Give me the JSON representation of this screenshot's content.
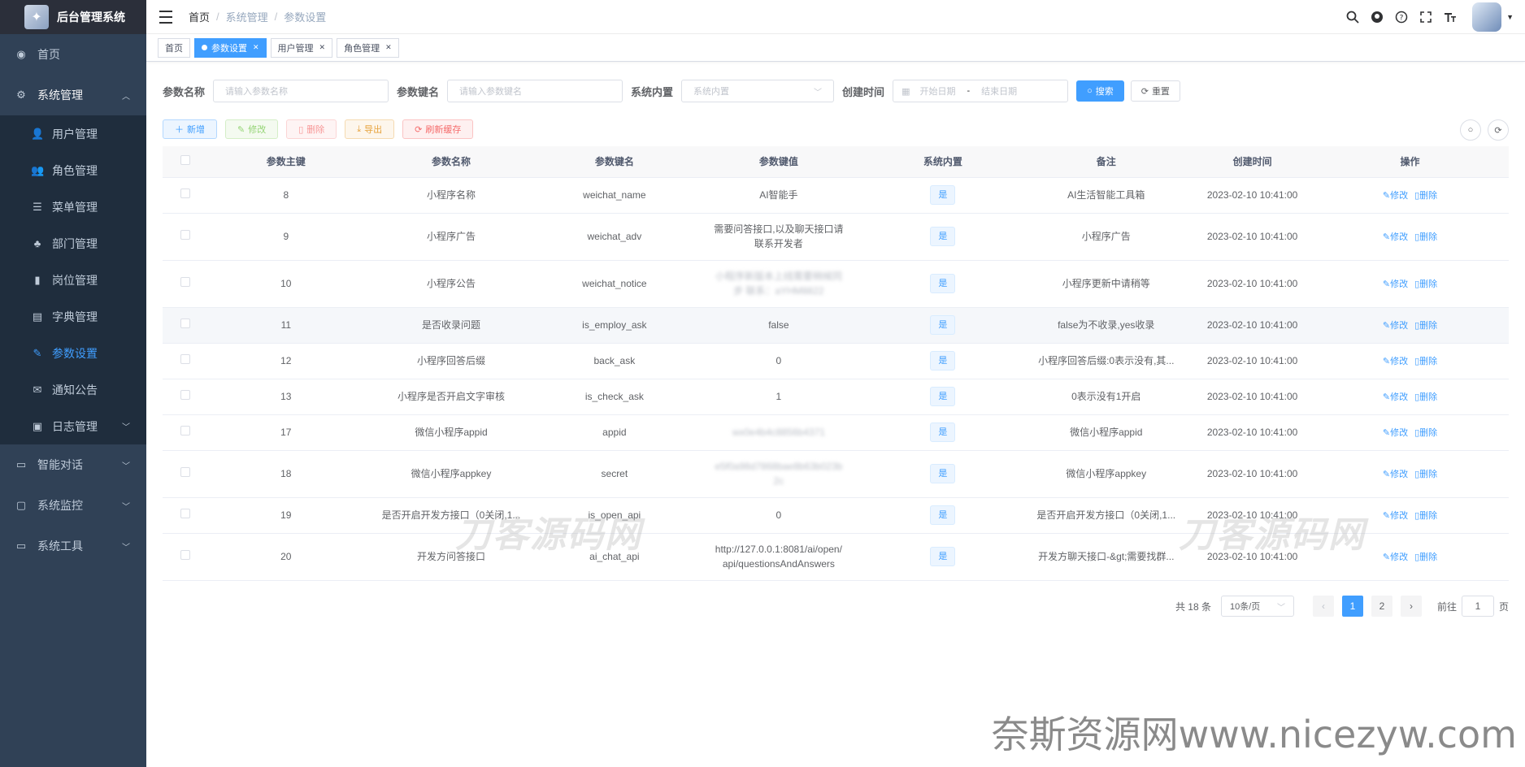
{
  "app": {
    "title": "后台管理系统"
  },
  "sidebar": {
    "items": [
      {
        "label": "首页",
        "icon": "dashboard-icon"
      },
      {
        "label": "系统管理",
        "icon": "gear-icon",
        "expanded": true,
        "children": [
          {
            "label": "用户管理",
            "icon": "user-icon"
          },
          {
            "label": "角色管理",
            "icon": "peoples-icon"
          },
          {
            "label": "菜单管理",
            "icon": "tree-table-icon"
          },
          {
            "label": "部门管理",
            "icon": "tree-icon"
          },
          {
            "label": "岗位管理",
            "icon": "post-icon"
          },
          {
            "label": "字典管理",
            "icon": "dict-icon"
          },
          {
            "label": "参数设置",
            "icon": "edit-icon",
            "active": true
          },
          {
            "label": "通知公告",
            "icon": "message-icon"
          },
          {
            "label": "日志管理",
            "icon": "log-icon"
          }
        ]
      },
      {
        "label": "智能对话",
        "icon": "chat-icon"
      },
      {
        "label": "系统监控",
        "icon": "monitor-icon"
      },
      {
        "label": "系统工具",
        "icon": "tool-icon"
      }
    ]
  },
  "navbar": {
    "breadcrumb": [
      "首页",
      "系统管理",
      "参数设置"
    ],
    "icons": [
      "search-icon",
      "github-icon",
      "question-icon",
      "fullscreen-icon",
      "font-size-icon"
    ]
  },
  "tags": [
    {
      "label": "首页",
      "closable": false,
      "active": false
    },
    {
      "label": "参数设置",
      "closable": true,
      "active": true
    },
    {
      "label": "用户管理",
      "closable": true,
      "active": false
    },
    {
      "label": "角色管理",
      "closable": true,
      "active": false
    }
  ],
  "search": {
    "param_name_label": "参数名称",
    "param_name_placeholder": "请输入参数名称",
    "param_key_label": "参数键名",
    "param_key_placeholder": "请输入参数键名",
    "builtin_label": "系统内置",
    "builtin_placeholder": "系统内置",
    "created_label": "创建时间",
    "start_placeholder": "开始日期",
    "end_placeholder": "结束日期",
    "range_separator": "-",
    "search_btn": "搜索",
    "reset_btn": "重置"
  },
  "toolbar": {
    "add": "新增",
    "edit": "修改",
    "delete": "删除",
    "export": "导出",
    "refresh_cache": "刷新缓存"
  },
  "table": {
    "columns": [
      "参数主键",
      "参数名称",
      "参数键名",
      "参数键值",
      "系统内置",
      "备注",
      "创建时间",
      "操作"
    ],
    "rows": [
      {
        "id": "8",
        "name": "小程序名称",
        "key": "weichat_name",
        "value": "AI智能手",
        "builtin": "是",
        "remark": "AI生活智能工具箱",
        "created": "2023-02-10 10:41:00",
        "blur": false
      },
      {
        "id": "9",
        "name": "小程序广告",
        "key": "weichat_adv",
        "value": "需要问答接口,以及聊天接口请联系开发者",
        "builtin": "是",
        "remark": "小程序广告",
        "created": "2023-02-10 10:41:00",
        "blur": false
      },
      {
        "id": "10",
        "name": "小程序公告",
        "key": "weichat_notice",
        "value": "小程序新版本上线需要稍候同步 联系：aYHM8822",
        "builtin": "是",
        "remark": "小程序更新中请稍等",
        "created": "2023-02-10 10:41:00",
        "blur": true
      },
      {
        "id": "11",
        "name": "是否收录问题",
        "key": "is_employ_ask",
        "value": "false",
        "builtin": "是",
        "remark": "false为不收录,yes收录",
        "created": "2023-02-10 10:41:00",
        "blur": false
      },
      {
        "id": "12",
        "name": "小程序回答后缀",
        "key": "back_ask",
        "value": "0",
        "builtin": "是",
        "remark": "小程序回答后缀:0表示没有,其...",
        "created": "2023-02-10 10:41:00",
        "blur": false
      },
      {
        "id": "13",
        "name": "小程序是否开启文字审核",
        "key": "is_check_ask",
        "value": "1",
        "builtin": "是",
        "remark": "0表示没有1开启",
        "created": "2023-02-10 10:41:00",
        "blur": false
      },
      {
        "id": "17",
        "name": "微信小程序appid",
        "key": "appid",
        "value": "wx0e4b4c8856b4371",
        "builtin": "是",
        "remark": "微信小程序appid",
        "created": "2023-02-10 10:41:00",
        "blur": true
      },
      {
        "id": "18",
        "name": "微信小程序appkey",
        "key": "secret",
        "value": "e5f0a98d7868bae8b63b023b2c",
        "builtin": "是",
        "remark": "微信小程序appkey",
        "created": "2023-02-10 10:41:00",
        "blur": true
      },
      {
        "id": "19",
        "name": "是否开启开发方接口（0关闭,1...",
        "key": "is_open_api",
        "value": "0",
        "builtin": "是",
        "remark": "是否开启开发方接口（0关闭,1...",
        "created": "2023-02-10 10:41:00",
        "blur": false
      },
      {
        "id": "20",
        "name": "开发方问答接口",
        "key": "ai_chat_api",
        "value": "http://127.0.0.1:8081/ai/open/api/questionsAndAnswers",
        "builtin": "是",
        "remark": "开发方聊天接口-&gt;需要找群...",
        "created": "2023-02-10 10:41:00",
        "blur": false
      }
    ],
    "op_edit": "修改",
    "op_delete": "删除"
  },
  "pagination": {
    "total": "共 18 条",
    "page_size": "10条/页",
    "pages": [
      "1",
      "2"
    ],
    "current": "1",
    "goto_prefix": "前往",
    "goto_value": "1",
    "goto_suffix": "页"
  },
  "watermarks": {
    "center1": "刀客源码网",
    "center2": "刀客源码网",
    "bottom": "奈斯资源网www.nicezyw.com"
  },
  "colors": {
    "sidebar_bg": "#304156",
    "primary": "#409eff"
  }
}
